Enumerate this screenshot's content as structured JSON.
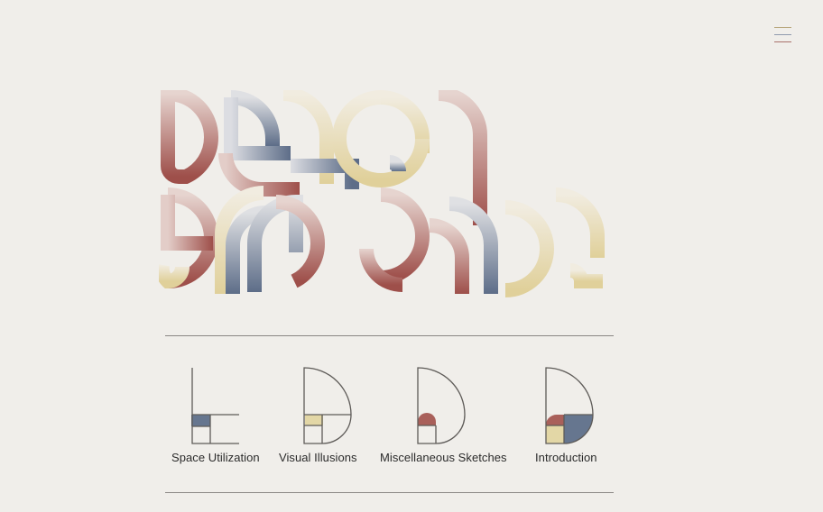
{
  "header": {
    "menu_icon": "hamburger-icon",
    "logo_icon": "design-playground-logo"
  },
  "nav": {
    "items": [
      {
        "label": "Space Utilization",
        "icon": "space-utilization-icon"
      },
      {
        "label": "Visual Illusions",
        "icon": "visual-illusions-icon"
      },
      {
        "label": "Miscellaneous Sketches",
        "icon": "miscellaneous-sketches-icon"
      },
      {
        "label": "Introduction",
        "icon": "introduction-icon"
      }
    ]
  },
  "colors": {
    "background": "#f0eeea",
    "rose": "#a9605a",
    "slate": "#66768f",
    "sand": "#e3d7a6",
    "line": "#5e5b58"
  }
}
